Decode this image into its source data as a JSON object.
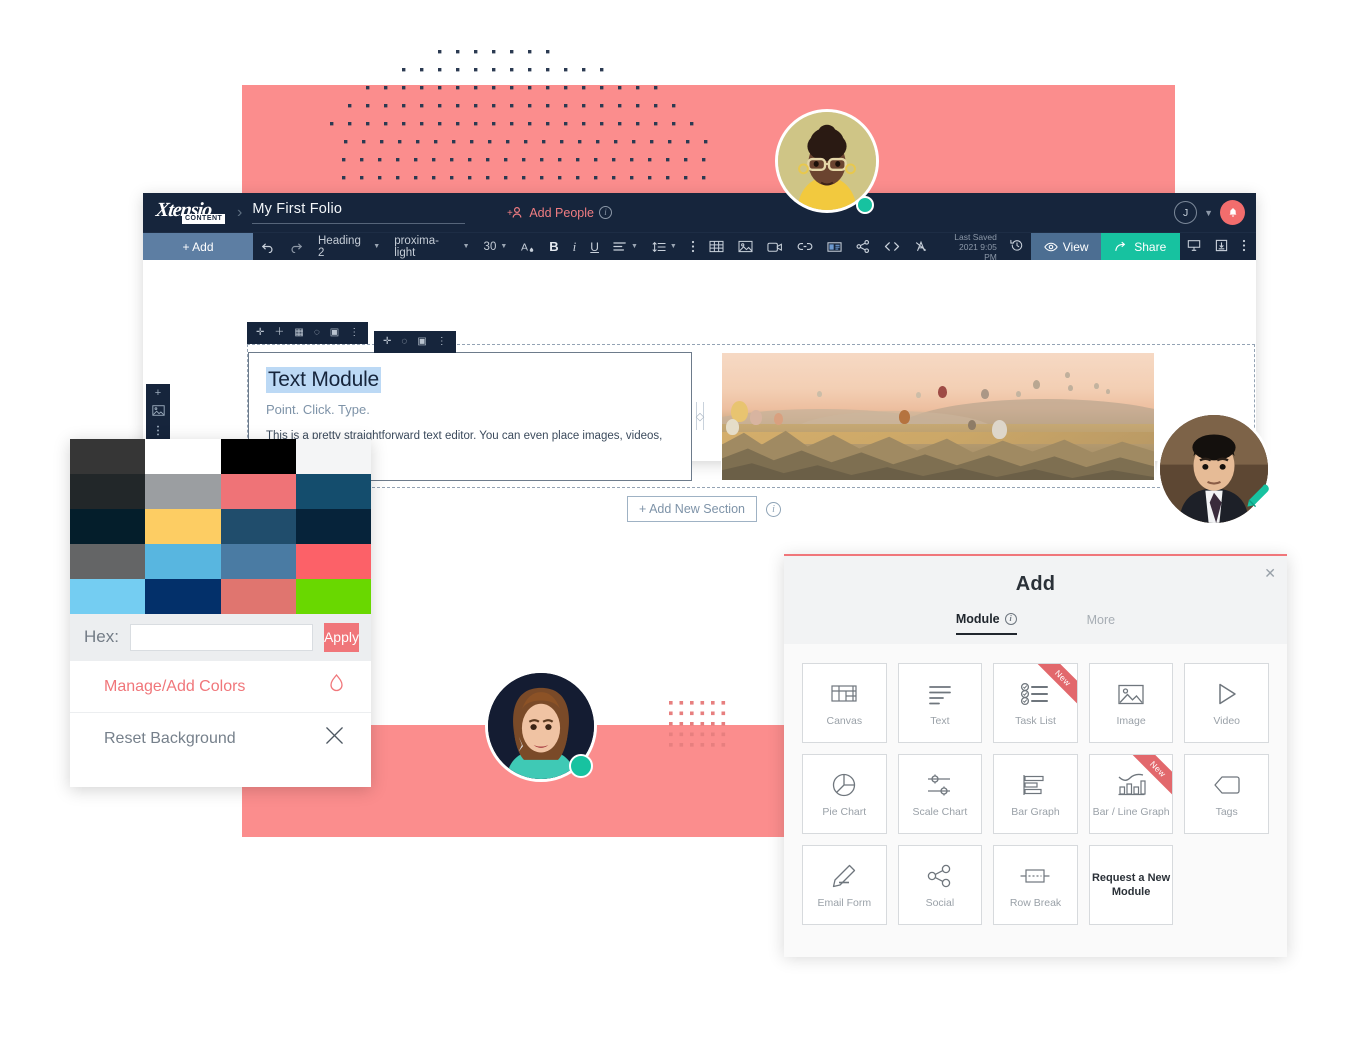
{
  "theme": {
    "pink": "#fb8d8d",
    "navy": "#16253c",
    "accent_red": "#f0767a",
    "teal": "#17c2a0",
    "toolbar_blue": "#5d7ea3"
  },
  "editor": {
    "logo": {
      "brand": "Xtensio",
      "sub": "CONTENT",
      "icon": "xtensio-logo-icon"
    },
    "breadcrumb_separator": "›",
    "folio_title": "My First Folio",
    "add_people_label": "Add People",
    "add_people_icon": "add-people-icon",
    "title_info_icon": "info-icon",
    "user_initial": "J",
    "user_chevron_icon": "chevron-down-icon",
    "notifications_icon": "bell-icon",
    "toolbar": {
      "add_label": "+ Add",
      "undo_icon": "undo-icon",
      "redo_icon": "redo-icon",
      "style_value": "Heading 2",
      "font_value": "proxima-light",
      "size_value": "30",
      "text_color_icon": "text-color-icon",
      "bold_label": "B",
      "italic_label": "i",
      "underline_label": "U",
      "align_icon": "align-left-icon",
      "line_height_icon": "line-height-icon",
      "more_text_icon": "more-vertical-icon",
      "table_icon": "table-icon",
      "image_icon": "image-icon",
      "video_icon": "video-icon",
      "link_icon": "link-icon",
      "embed_icon": "embed-icon",
      "social_icon": "share-nodes-icon",
      "code_icon": "code-icon",
      "clear_format_icon": "clear-formatting-icon",
      "last_saved_line1": "Last Saved",
      "last_saved_line2": "2021 9:05 PM",
      "history_icon": "history-icon",
      "view_label": "View",
      "view_icon": "eye-icon",
      "share_label": "Share",
      "share_icon": "share-arrow-icon",
      "present_icon": "presentation-icon",
      "download_icon": "download-icon",
      "overflow_icon": "more-vertical-icon"
    },
    "left_rail": {
      "add_icon": "plus-icon",
      "image_icon": "image-icon",
      "more_icon": "more-vertical-icon"
    },
    "module_toolbar_1": [
      "move-icon",
      "plus-icon",
      "grid-icon",
      "drop-icon",
      "image-icon",
      "more-vertical-icon"
    ],
    "module_toolbar_2": [
      "move-icon",
      "drop-icon",
      "image-icon",
      "more-vertical-icon"
    ],
    "text_module": {
      "title": "Text Module",
      "subtitle": "Point. Click. Type.",
      "body": "This is a pretty straightforward text editor. You can even place images, videos, tables, and links."
    },
    "column_handle_icon": "column-resize-icon",
    "image_module_alt": "hot-air-balloons-landscape",
    "add_new_section_label": "+ Add New Section",
    "add_new_section_info_icon": "info-icon"
  },
  "color_panel": {
    "swatches": [
      "#363636",
      "#ffffff",
      "#000000",
      "#f4f5f6",
      "#222729",
      "#9b9ea1",
      "#ef7377",
      "#144d6d",
      "#041e2b",
      "#fdcd63",
      "#204d6c",
      "#06233a",
      "#646566",
      "#58b6e0",
      "#4a7ba3",
      "#fc6168",
      "#74cdf2",
      "#03306a",
      "#e0756f",
      "#69d800"
    ],
    "hex_label": "Hex:",
    "hex_value": "",
    "hex_placeholder": "",
    "apply_label": "Apply",
    "manage_colors_label": "Manage/Add Colors",
    "manage_colors_icon": "drop-icon",
    "reset_background_label": "Reset Background",
    "reset_background_icon": "close-x-icon"
  },
  "add_modal": {
    "title": "Add",
    "close_icon": "close-icon",
    "tabs": [
      {
        "label": "Module",
        "active": true,
        "info_icon": "info-icon"
      },
      {
        "label": "More",
        "active": false
      }
    ],
    "modules": [
      {
        "label": "Canvas",
        "icon": "canvas-icon",
        "badge": ""
      },
      {
        "label": "Text",
        "icon": "text-icon",
        "badge": ""
      },
      {
        "label": "Task List",
        "icon": "task-list-icon",
        "badge": "New"
      },
      {
        "label": "Image",
        "icon": "image-icon",
        "badge": ""
      },
      {
        "label": "Video",
        "icon": "video-play-icon",
        "badge": ""
      },
      {
        "label": "Pie Chart",
        "icon": "pie-chart-icon",
        "badge": ""
      },
      {
        "label": "Scale Chart",
        "icon": "sliders-icon",
        "badge": ""
      },
      {
        "label": "Bar Graph",
        "icon": "bar-graph-icon",
        "badge": ""
      },
      {
        "label": "Bar / Line Graph",
        "icon": "bar-line-icon",
        "badge": "New"
      },
      {
        "label": "Tags",
        "icon": "tag-icon",
        "badge": ""
      },
      {
        "label": "Email Form",
        "icon": "pencil-icon",
        "badge": ""
      },
      {
        "label": "Social",
        "icon": "share-nodes-icon",
        "badge": ""
      },
      {
        "label": "Row Break",
        "icon": "row-break-icon",
        "badge": ""
      },
      {
        "label": "Request a New Module",
        "icon": "",
        "badge": ""
      }
    ]
  },
  "avatars": [
    {
      "name": "collaborator-top",
      "status": "online",
      "status_color": "#17c2a0"
    },
    {
      "name": "collaborator-right",
      "status": "editing",
      "badge_icon": "pencil-icon",
      "badge_color": "#17c2a0"
    },
    {
      "name": "collaborator-bottom",
      "status": "online",
      "status_color": "#17c2a0"
    }
  ]
}
